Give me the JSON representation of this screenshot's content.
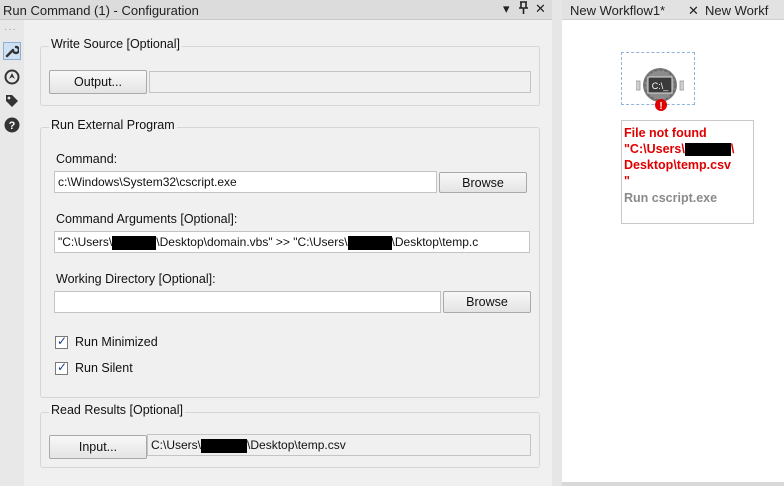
{
  "panel": {
    "title": "Run Command (1) - Configuration",
    "dropdown_glyph": "▾",
    "pin_glyph": "⊥",
    "close_glyph": "✕"
  },
  "write_source": {
    "title": "Write Source [Optional]",
    "output_button": "Output...",
    "output_value": ""
  },
  "run_external": {
    "title": "Run External Program",
    "command_label": "Command:",
    "command_value": "c:\\Windows\\System32\\cscript.exe",
    "browse_label": "Browse",
    "args_label": "Command Arguments [Optional]:",
    "args_part1": "\"C:\\Users\\",
    "args_part2": "\\Desktop\\domain.vbs\" >> \"C:\\Users\\",
    "args_part3": "\\Desktop\\temp.c",
    "workdir_label": "Working Directory [Optional]:",
    "workdir_value": "",
    "workdir_browse": "Browse",
    "run_minimized": "Run Minimized",
    "run_silent": "Run Silent",
    "run_minimized_checked": true,
    "run_silent_checked": true
  },
  "read_results": {
    "title": "Read Results [Optional]",
    "input_button": "Input...",
    "path_part1": "C:\\Users\\",
    "path_part2": "\\Desktop\\temp.csv"
  },
  "canvas": {
    "tab1": "New Workflow1*",
    "tab_close": "✕",
    "tab2": "New Workf",
    "icon_text": "C:\\_",
    "error_lines": [
      "File not found",
      "\"C:\\Users\\",
      "Desktop\\temp.csv",
      "\""
    ],
    "tool_name": "Run cscript.exe"
  },
  "colors": {
    "error_red": "#e00000",
    "tool_gray": "#8a8a8a",
    "check_blue": "#1a3a8f"
  }
}
